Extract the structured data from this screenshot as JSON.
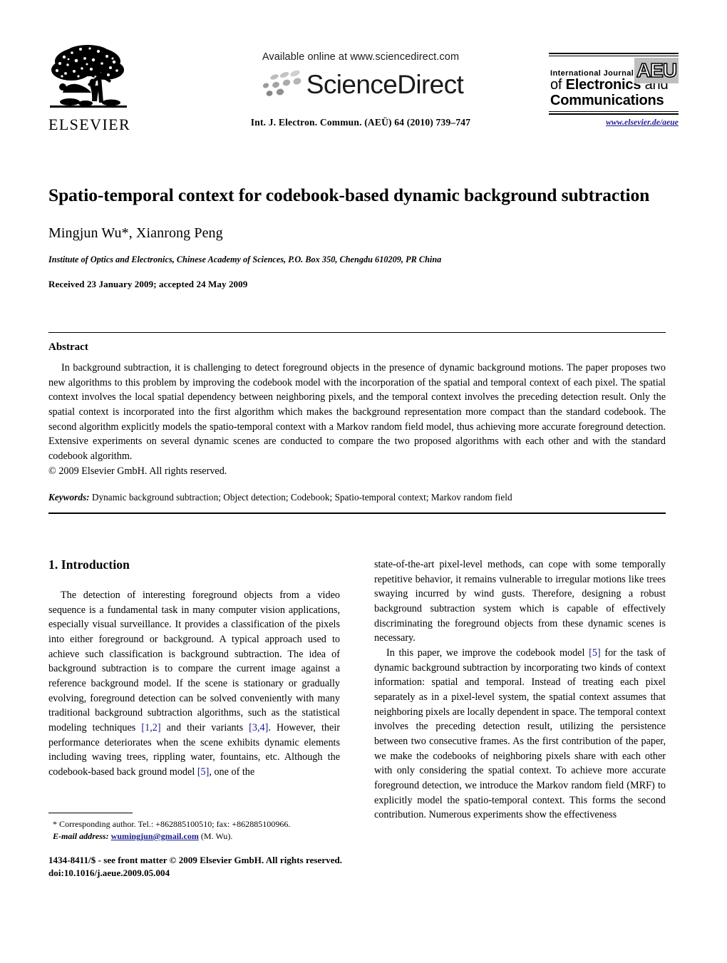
{
  "masthead": {
    "publisher_name": "ELSEVIER",
    "publisher_logo_icon": "elsevier-tree-logo",
    "available_online": "Available online at www.sciencedirect.com",
    "sciencedirect_wordmark": "ScienceDirect",
    "sciencedirect_dots_icon": "sciencedirect-dots-logo",
    "citation": "Int. J. Electron. Commun. (AEÜ) 64 (2010) 739–747",
    "journal_logo": {
      "line1": "International Journal",
      "line2_bold": "Electronics",
      "line2_prefix": "of ",
      "line2_suffix": " and",
      "line3": "Communications",
      "badge": "AEU",
      "url": "www.elsevier.de/aeue",
      "url_color": "#1b1b8f"
    }
  },
  "article": {
    "title": "Spatio-temporal context for codebook-based dynamic background subtraction",
    "authors": "Mingjun Wu*, Xianrong Peng",
    "affiliation": "Institute of Optics and Electronics, Chinese Academy of Sciences, P.O. Box 350, Chengdu 610209, PR China",
    "history": "Received 23 January 2009; accepted 24 May 2009"
  },
  "abstract": {
    "heading": "Abstract",
    "body": "In background subtraction, it is challenging to detect foreground objects in the presence of dynamic background motions. The paper proposes two new algorithms to this problem by improving the codebook model with the incorporation of the spatial and temporal context of each pixel. The spatial context involves the local spatial dependency between neighboring pixels, and the temporal context involves the preceding detection result. Only the spatial context is incorporated into the first algorithm which makes the background representation more compact than the standard codebook. The second algorithm explicitly models the spatio-temporal context with a Markov random field model, thus achieving more accurate foreground detection. Extensive experiments on several dynamic scenes are conducted to compare the two proposed algorithms with each other and with the standard codebook algorithm.",
    "copyright": "© 2009 Elsevier GmbH. All rights reserved.",
    "keywords_label": "Keywords:",
    "keywords_value": " Dynamic background subtraction; Object detection; Codebook; Spatio-temporal context; Markov random field"
  },
  "body": {
    "section_number_title": "1. Introduction",
    "left_para1_a": "The detection of interesting foreground objects from a video sequence is a fundamental task in many computer vision applications, especially visual surveillance. It provides a classification of the pixels into either foreground or background. A typical approach used to achieve such classification is background subtraction. The idea of background subtraction is to compare the current image against a reference background model. If the scene is stationary or gradually evolving, foreground detection can be solved conveniently with many traditional background subtraction algorithms, such as the statistical modeling techniques ",
    "cit_12": "[1,2]",
    "left_para1_b": " and their variants ",
    "cit_34": "[3,4]",
    "left_para1_c": ". However, their performance deteriorates when the scene exhibits dynamic elements including waving trees, rippling water, fountains, etc. Although the codebook-based back ground model ",
    "cit_5a": "[5]",
    "left_para1_d": ", one of the",
    "right_para1": "state-of-the-art pixel-level methods, can cope with some temporally repetitive behavior, it remains vulnerable to irregular motions like trees swaying incurred by wind gusts. Therefore, designing a robust background subtraction system which is capable of effectively discriminating the foreground objects from these dynamic scenes is necessary.",
    "right_para2_a": "In this paper, we improve the codebook model ",
    "cit_5b": "[5]",
    "right_para2_b": " for the task of dynamic background subtraction by incorporating two kinds of context information: spatial and temporal. Instead of treating each pixel separately as in a pixel-level system, the spatial context assumes that neighboring pixels are locally dependent in space. The temporal context involves the preceding detection result, utilizing the persistence between two consecutive frames. As the first contribution of the paper, we make the codebooks of neighboring pixels share with each other with only considering the spatial context. To achieve more accurate foreground detection, we introduce the Markov random field (MRF) to explicitly model the spatio-temporal context. This forms the second contribution. Numerous experiments show the effectiveness"
  },
  "footnote": {
    "star": "*",
    "corresponding": " Corresponding author. Tel.: +862885100510; fax: +862885100966.",
    "email_label": "E-mail address:",
    "email": "wumingjun@gmail.com",
    "email_suffix": " (M. Wu)."
  },
  "footer": {
    "line1": "1434-8411/$ - see front matter © 2009 Elsevier GmbH. All rights reserved.",
    "line2": "doi:10.1016/j.aeue.2009.05.004"
  }
}
